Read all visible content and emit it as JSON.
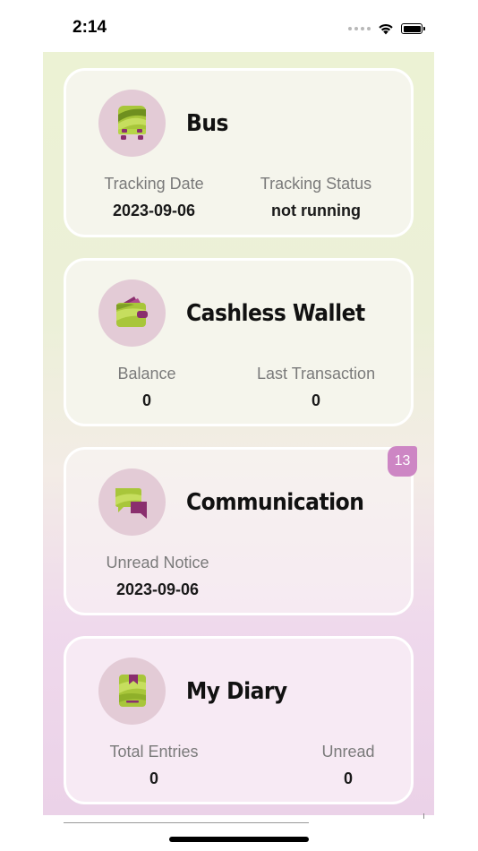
{
  "status_bar": {
    "time": "2:14"
  },
  "cards": [
    {
      "id": "bus",
      "title": "Bus",
      "icon": "bus-icon",
      "fields": [
        {
          "label": "Tracking Date",
          "value": "2023-09-06"
        },
        {
          "label": "Tracking Status",
          "value": "not running"
        }
      ]
    },
    {
      "id": "wallet",
      "title": "Cashless Wallet",
      "icon": "wallet-icon",
      "fields": [
        {
          "label": "Balance",
          "value": "0"
        },
        {
          "label": "Last Transaction",
          "value": "0"
        }
      ]
    },
    {
      "id": "communication",
      "title": "Communication",
      "icon": "chat-icon",
      "badge": "13",
      "fields": [
        {
          "label": "Unread Notice",
          "value": "2023-09-06"
        }
      ]
    },
    {
      "id": "diary",
      "title": "My Diary",
      "icon": "diary-icon",
      "fields": [
        {
          "label": "Total Entries",
          "value": "0"
        },
        {
          "label": "Unread",
          "value": "0"
        }
      ]
    }
  ],
  "colors": {
    "accent_green": "#a8c63a",
    "accent_purple": "#8a2f6e",
    "badge": "#cd86c4",
    "icon_circle": "#e3cbd6"
  }
}
